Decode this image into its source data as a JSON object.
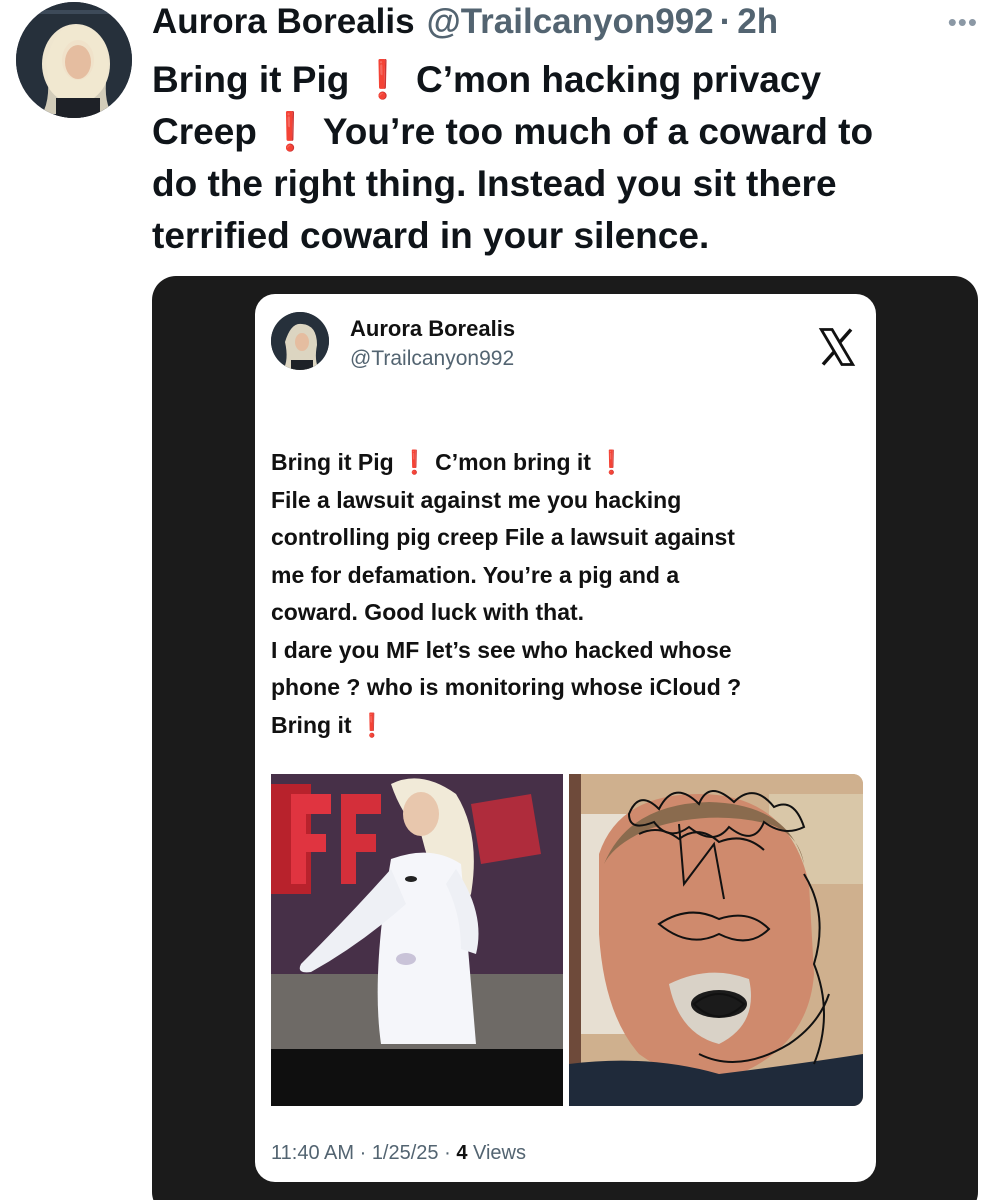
{
  "tweet": {
    "author_name": "Aurora Borealis",
    "handle": "@Trailcanyon992",
    "separator": "·",
    "time": "2h",
    "more_icon": "more-horizontal-icon",
    "lines": [
      {
        "pre": "Bring it Pig ",
        "excl": "❗",
        "post": " C’mon hacking privacy"
      },
      {
        "pre": "Creep ",
        "excl": "❗",
        "post": " You’re  too much of a coward to"
      },
      {
        "pre": "do the right thing. Instead you sit there",
        "excl": "",
        "post": ""
      },
      {
        "pre": "terrified coward in your silence.",
        "excl": "",
        "post": ""
      }
    ]
  },
  "embedded_card": {
    "author_name": "Aurora Borealis",
    "handle": "@Trailcanyon992",
    "brand_icon": "x-logo-icon",
    "lines": [
      {
        "pre": "Bring it Pig ",
        "excl": "❗",
        "mid": " C’mon  bring it ",
        "excl2": "❗"
      },
      {
        "pre": "File a lawsuit against me you hacking",
        "excl": "",
        "mid": "",
        "excl2": ""
      },
      {
        "pre": "controlling pig creep File a lawsuit against",
        "excl": "",
        "mid": "",
        "excl2": ""
      },
      {
        "pre": "me for defamation. You’re a pig and a",
        "excl": "",
        "mid": "",
        "excl2": ""
      },
      {
        "pre": "coward. Good luck with that.",
        "excl": "",
        "mid": "",
        "excl2": ""
      },
      {
        "pre": " I dare you MF let’s see who hacked whose",
        "excl": "",
        "mid": "",
        "excl2": ""
      },
      {
        "pre": "phone ?  who is monitoring whose iCloud  ?",
        "excl": "",
        "mid": "",
        "excl2": ""
      },
      {
        "pre": "Bring it ",
        "excl": "❗",
        "mid": "",
        "excl2": ""
      }
    ],
    "footer": {
      "time": "11:40 AM",
      "sep1": " · ",
      "date": "1/25/25",
      "sep2": " · ",
      "views_count": "4",
      "views_label": " Views"
    }
  },
  "colors": {
    "text": "#0f1419",
    "secondary": "#536471",
    "exclamation": "#e0211a",
    "media_bg": "#1b1b1b"
  }
}
